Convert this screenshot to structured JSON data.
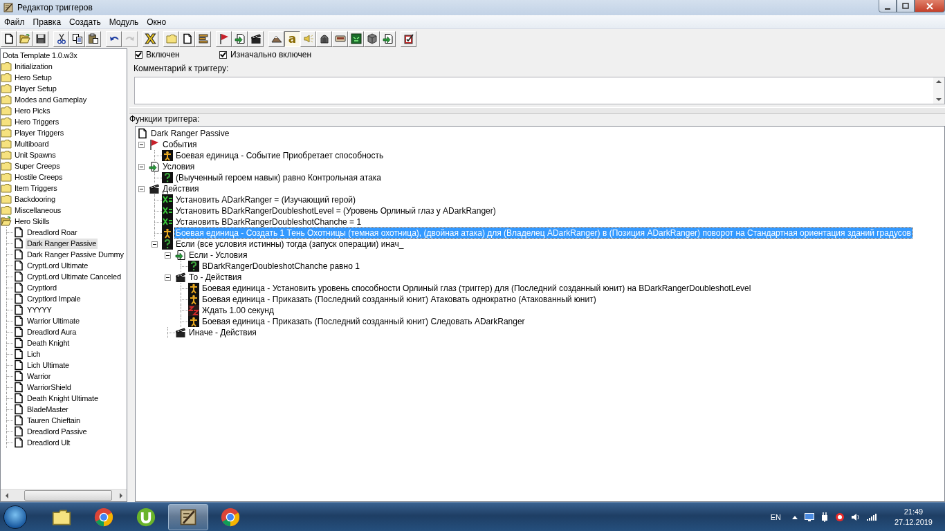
{
  "window": {
    "title": "Редактор триггеров"
  },
  "menu": [
    {
      "label": "Файл"
    },
    {
      "label": "Правка"
    },
    {
      "label": "Создать"
    },
    {
      "label": "Модуль"
    },
    {
      "label": "Окно"
    }
  ],
  "toolbar": [
    [
      {
        "kind": "doc"
      },
      {
        "kind": "open-folder"
      },
      {
        "kind": "floppy"
      }
    ],
    [
      {
        "kind": "scissors"
      },
      {
        "kind": "copy"
      },
      {
        "kind": "clipboard"
      }
    ],
    [
      {
        "kind": "undo",
        "disabled": false
      },
      {
        "kind": "redo",
        "disabled": true
      }
    ],
    [
      {
        "kind": "glyph",
        "glyph": "X"
      }
    ],
    [
      {
        "kind": "folder"
      },
      {
        "kind": "doc"
      },
      {
        "kind": "lines"
      }
    ],
    [
      {
        "kind": "flag"
      },
      {
        "kind": "doc-arrow"
      },
      {
        "kind": "clapper"
      }
    ],
    [
      {
        "kind": "mountain",
        "pressed": false
      },
      {
        "kind": "glyph",
        "glyph": "a",
        "pressed": true
      },
      {
        "kind": "speaker",
        "pressed": false
      },
      {
        "kind": "helmet",
        "pressed": false
      },
      {
        "kind": "panel",
        "pressed": false
      },
      {
        "kind": "monster",
        "pressed": false
      },
      {
        "kind": "cube",
        "pressed": false
      },
      {
        "kind": "doc-arrow",
        "pressed": false
      }
    ],
    [
      {
        "kind": "doc-check"
      }
    ]
  ],
  "map_tree": {
    "root": "Dota Template 1.0.w3x",
    "folders": [
      {
        "label": "Initialization",
        "expanded": false,
        "selected": false
      },
      {
        "label": "Hero Setup",
        "expanded": false,
        "selected": false
      },
      {
        "label": "Player Setup",
        "expanded": false,
        "selected": false
      },
      {
        "label": "Modes and Gameplay",
        "expanded": false,
        "selected": false
      },
      {
        "label": "Hero Picks",
        "expanded": false,
        "selected": false
      },
      {
        "label": "Hero Triggers",
        "expanded": false,
        "selected": false
      },
      {
        "label": "Player Triggers",
        "expanded": false,
        "selected": false
      },
      {
        "label": "Multiboard",
        "expanded": false,
        "selected": false
      },
      {
        "label": "Unit Spawns",
        "expanded": false,
        "selected": false
      },
      {
        "label": "Super Creeps",
        "expanded": false,
        "selected": false
      },
      {
        "label": "Hostile Creeps",
        "expanded": false,
        "selected": false
      },
      {
        "label": "Item Triggers",
        "expanded": false,
        "selected": false
      },
      {
        "label": "Backdooring",
        "expanded": false,
        "selected": false
      },
      {
        "label": "Miscellaneous",
        "expanded": false,
        "selected": false
      },
      {
        "label": "Hero Skills",
        "expanded": true,
        "selected": false,
        "children": [
          {
            "label": "Dreadlord Roar",
            "selected": false
          },
          {
            "label": "Dark Ranger Passive",
            "selected": true
          },
          {
            "label": "Dark Ranger Passive Dummy",
            "selected": false
          },
          {
            "label": "CryptLord Ultimate",
            "selected": false
          },
          {
            "label": "CryptLord Ultimate Canceled",
            "selected": false
          },
          {
            "label": "Cryptlord",
            "selected": false
          },
          {
            "label": "Cryptlord Impale",
            "selected": false
          },
          {
            "label": "YYYYY",
            "selected": false
          },
          {
            "label": "Warrior Ultimate",
            "selected": false
          },
          {
            "label": "Dreadlord Aura",
            "selected": false
          },
          {
            "label": "Death Knight",
            "selected": false
          },
          {
            "label": "Lich",
            "selected": false
          },
          {
            "label": "Lich Ultimate",
            "selected": false
          },
          {
            "label": "Warrior",
            "selected": false
          },
          {
            "label": "WarriorShield",
            "selected": false
          },
          {
            "label": "Death Knight Ultimate",
            "selected": false
          },
          {
            "label": "BladeMaster",
            "selected": false
          },
          {
            "label": "Tauren Chieftain",
            "selected": false
          },
          {
            "label": "Dreadlord Passive",
            "selected": false
          },
          {
            "label": "Dreadlord Ult",
            "selected": false
          }
        ]
      }
    ]
  },
  "options": [
    {
      "label": "Включен",
      "checked": true
    },
    {
      "label": "Изначально включен",
      "checked": true
    }
  ],
  "comment": {
    "label": "Комментарий к триггеру:"
  },
  "functions": {
    "label": "Функции триггера:",
    "tree": {
      "kind": "doc",
      "label": "Dark Ranger Passive",
      "selected": false,
      "children": [
        {
          "kind": "flag",
          "label": "События",
          "expanded": true,
          "selected": false,
          "children": [
            {
              "kind": "unit",
              "label": "Боевая единица - Событие Приобретает способность",
              "selected": false
            }
          ]
        },
        {
          "kind": "doc-arrow",
          "label": "Условия",
          "expanded": true,
          "selected": false,
          "children": [
            {
              "kind": "question",
              "label": "(Выученный героем навык) равно Контрольная атака",
              "selected": false
            }
          ]
        },
        {
          "kind": "clapper",
          "label": "Действия",
          "expanded": true,
          "selected": false,
          "children": [
            {
              "kind": "set",
              "label": "Установить ADarkRanger = (Изучающий герой)",
              "selected": false
            },
            {
              "kind": "set",
              "label": "Установить BDarkRangerDoubleshotLevel = (Уровень Орлиный глаз  у ADarkRanger)",
              "selected": false
            },
            {
              "kind": "set",
              "label": "Установить BDarkRangerDoubleshotChanche = 1",
              "selected": false
            },
            {
              "kind": "unit",
              "label": "Боевая единица - Создать 1 Тень Охотницы (темная охотница), (двойная атака) для (Владелец ADarkRanger) в (Позиция ADarkRanger) поворот на Стандартная ориентация зданий градусов",
              "selected": true
            },
            {
              "kind": "question",
              "label": "Если (все условия истинны) тогда (запуск операции) инач_",
              "expanded": true,
              "selected": false,
              "children": [
                {
                  "kind": "doc-arrow",
                  "label": "Если - Условия",
                  "expanded": true,
                  "selected": false,
                  "children": [
                    {
                      "kind": "question",
                      "label": "BDarkRangerDoubleshotChanche равно 1",
                      "selected": false
                    }
                  ]
                },
                {
                  "kind": "clapper",
                  "label": "То - Действия",
                  "expanded": true,
                  "selected": false,
                  "children": [
                    {
                      "kind": "unit",
                      "label": "Боевая единица - Установить уровень способности Орлиный глаз (триггер) для (Последний созданный юнит) на BDarkRangerDoubleshotLevel",
                      "selected": false
                    },
                    {
                      "kind": "unit",
                      "label": "Боевая единица - Приказать (Последний созданный юнит) Атаковать однократно (Атакованный юнит)",
                      "selected": false
                    },
                    {
                      "kind": "wait",
                      "label": "Ждать 1.00 секунд",
                      "selected": false
                    },
                    {
                      "kind": "unit",
                      "label": "Боевая единица - Приказать (Последний созданный юнит) Следовать ADarkRanger",
                      "selected": false
                    }
                  ]
                },
                {
                  "kind": "clapper",
                  "label": "Иначе - Действия",
                  "selected": false
                }
              ]
            }
          ]
        }
      ]
    }
  },
  "taskbar": {
    "apps": [
      {
        "kind": "folder",
        "active": false
      },
      {
        "kind": "chrome",
        "active": false
      },
      {
        "kind": "utorrent",
        "active": false
      },
      {
        "kind": "editor",
        "active": true
      },
      {
        "kind": "chrome",
        "active": false
      }
    ],
    "language": "EN",
    "time": "21:49",
    "date": "27.12.2019"
  }
}
